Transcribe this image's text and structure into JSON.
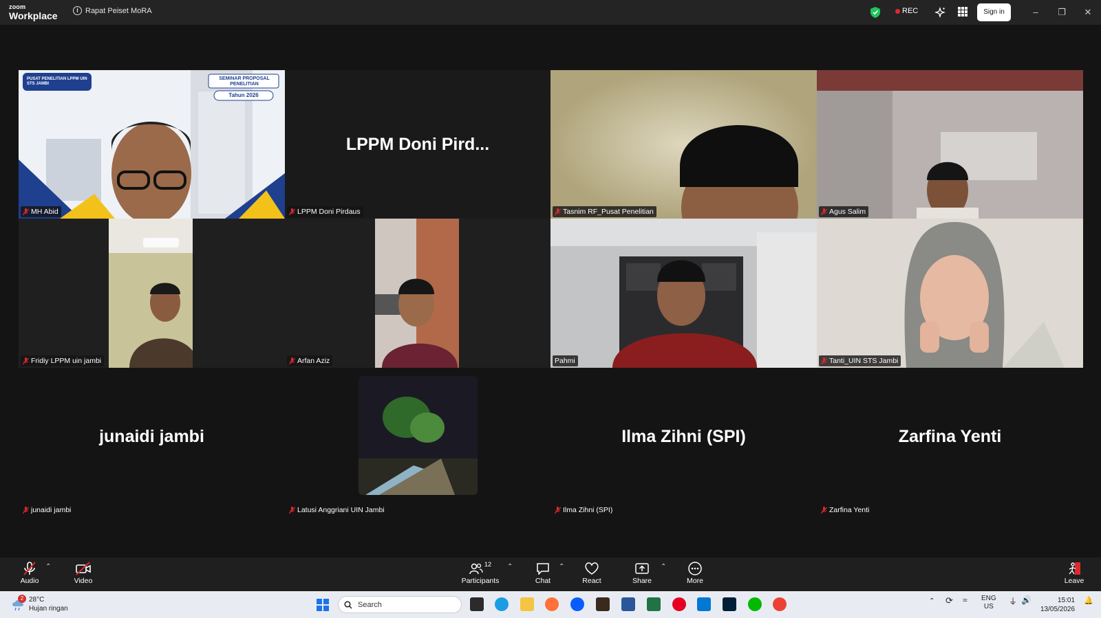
{
  "window": {
    "logo_small": "zoom",
    "logo_big": "Workplace",
    "meeting_title": "Rapat Peiset MoRA",
    "rec_label": "REC",
    "signin_label": "Sign in"
  },
  "tiles": [
    {
      "name": "MH Abid",
      "big_label": "",
      "banner_left": "PUSAT PENELITIAN LPPM UIN STS JAMBI",
      "banner_right": "SEMINAR PROPOSAL PENELITIAN",
      "banner_year": "Tahun 2026"
    },
    {
      "name": "LPPM Doni Pirdaus",
      "big_label": "LPPM  Doni  Pird..."
    },
    {
      "name": "Tasnim RF_Pusat Penelitian"
    },
    {
      "name": "Agus Salim"
    },
    {
      "name": "Fridiy LPPM uin jambi"
    },
    {
      "name": "Arfan Aziz"
    },
    {
      "name": "Pahmi"
    },
    {
      "name": "Tanti_UIN STS Jambi"
    },
    {
      "name": "junaidi jambi",
      "big_label": "junaidi jambi"
    },
    {
      "name": "Latusi Anggriani UIN Jambi"
    },
    {
      "name": "Ilma Zihni (SPI)",
      "big_label": "Ilma Zihni (SPI)"
    },
    {
      "name": "Zarfina Yenti",
      "big_label": "Zarfina Yenti"
    }
  ],
  "toolbar": {
    "audio": "Audio",
    "video": "Video",
    "participants": "Participants",
    "participants_count": "12",
    "chat": "Chat",
    "react": "React",
    "share": "Share",
    "more": "More",
    "leave": "Leave"
  },
  "taskbar": {
    "weather_badge": "2",
    "temperature": "28°C",
    "weather_desc": "Hujan ringan",
    "search_placeholder": "Search",
    "lang_top": "ENG",
    "lang_bottom": "US",
    "time": "15:01",
    "date": "13/05/2026"
  },
  "colors": {
    "active_speaker": "#2ecc71",
    "rec_dot": "#e0292f",
    "shield": "#22c55e"
  }
}
